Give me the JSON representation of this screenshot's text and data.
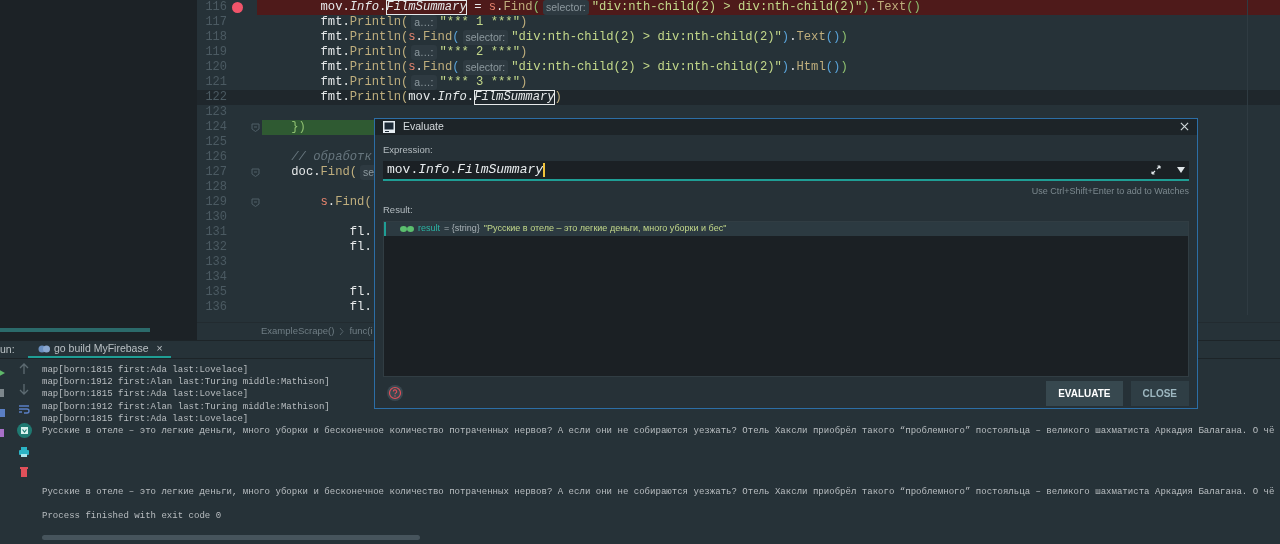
{
  "editor": {
    "lines": [
      {
        "number": "116",
        "breakpoint": true,
        "current": false,
        "highlighted": false,
        "foldable": false,
        "tokens": [
          {
            "text": "        mov.",
            "kind": "plain"
          },
          {
            "text": "Info",
            "kind": "field"
          },
          {
            "text": ".",
            "kind": "plain"
          },
          {
            "text": "FilmSummary",
            "kind": "boxed"
          },
          {
            "text": " = ",
            "kind": "plain"
          },
          {
            "text": "s",
            "kind": "receiver"
          },
          {
            "text": ".",
            "kind": "plain"
          },
          {
            "text": "Find",
            "kind": "method"
          },
          {
            "text": "(",
            "kind": "paren-green"
          },
          {
            "text": "selector:",
            "kind": "hint"
          },
          {
            "text": "\"div:nth-child(2) > div:nth-child(2)\"",
            "kind": "string"
          },
          {
            "text": ")",
            "kind": "paren-green"
          },
          {
            "text": ".",
            "kind": "plain"
          },
          {
            "text": "Text",
            "kind": "method"
          },
          {
            "text": "()",
            "kind": "paren-green"
          }
        ]
      },
      {
        "number": "117",
        "breakpoint": false,
        "current": false,
        "highlighted": false,
        "foldable": false,
        "tokens": [
          {
            "text": "        fmt.",
            "kind": "plain"
          },
          {
            "text": "Println(",
            "kind": "method"
          },
          {
            "text": "a…:",
            "kind": "hint"
          },
          {
            "text": "\"*** 1 ***\"",
            "kind": "string"
          },
          {
            "text": ")",
            "kind": "method"
          }
        ]
      },
      {
        "number": "118",
        "breakpoint": false,
        "current": false,
        "highlighted": false,
        "foldable": false,
        "tokens": [
          {
            "text": "        fmt.",
            "kind": "plain"
          },
          {
            "text": "Println(",
            "kind": "method"
          },
          {
            "text": "s",
            "kind": "receiver"
          },
          {
            "text": ".",
            "kind": "plain"
          },
          {
            "text": "Find",
            "kind": "method"
          },
          {
            "text": "(",
            "kind": "paren-blue"
          },
          {
            "text": "selector:",
            "kind": "hint"
          },
          {
            "text": "\"div:nth-child(2) > div:nth-child(2)\"",
            "kind": "string"
          },
          {
            "text": ")",
            "kind": "paren-blue"
          },
          {
            "text": ".",
            "kind": "plain"
          },
          {
            "text": "Text",
            "kind": "method"
          },
          {
            "text": "()",
            "kind": "paren-blue"
          },
          {
            "text": ")",
            "kind": "paren-green"
          }
        ]
      },
      {
        "number": "119",
        "breakpoint": false,
        "current": false,
        "highlighted": false,
        "foldable": false,
        "tokens": [
          {
            "text": "        fmt.",
            "kind": "plain"
          },
          {
            "text": "Println(",
            "kind": "method"
          },
          {
            "text": "a…:",
            "kind": "hint"
          },
          {
            "text": "\"*** 2 ***\"",
            "kind": "string"
          },
          {
            "text": ")",
            "kind": "method"
          }
        ]
      },
      {
        "number": "120",
        "breakpoint": false,
        "current": false,
        "highlighted": false,
        "foldable": false,
        "tokens": [
          {
            "text": "        fmt.",
            "kind": "plain"
          },
          {
            "text": "Println(",
            "kind": "method"
          },
          {
            "text": "s",
            "kind": "receiver"
          },
          {
            "text": ".",
            "kind": "plain"
          },
          {
            "text": "Find",
            "kind": "method"
          },
          {
            "text": "(",
            "kind": "paren-blue"
          },
          {
            "text": "selector:",
            "kind": "hint"
          },
          {
            "text": "\"div:nth-child(2) > div:nth-child(2)\"",
            "kind": "string"
          },
          {
            "text": ")",
            "kind": "paren-blue"
          },
          {
            "text": ".",
            "kind": "plain"
          },
          {
            "text": "Html",
            "kind": "method"
          },
          {
            "text": "()",
            "kind": "paren-blue"
          },
          {
            "text": ")",
            "kind": "paren-green"
          }
        ]
      },
      {
        "number": "121",
        "breakpoint": false,
        "current": false,
        "highlighted": false,
        "foldable": false,
        "tokens": [
          {
            "text": "        fmt.",
            "kind": "plain"
          },
          {
            "text": "Println(",
            "kind": "method"
          },
          {
            "text": "a…:",
            "kind": "hint"
          },
          {
            "text": "\"*** 3 ***\"",
            "kind": "string"
          },
          {
            "text": ")",
            "kind": "method"
          }
        ]
      },
      {
        "number": "122",
        "breakpoint": false,
        "current": true,
        "highlighted": false,
        "foldable": false,
        "tokens": [
          {
            "text": "        fmt.",
            "kind": "plain"
          },
          {
            "text": "Println(",
            "kind": "method"
          },
          {
            "text": "mov.",
            "kind": "plain"
          },
          {
            "text": "Info",
            "kind": "field"
          },
          {
            "text": ".",
            "kind": "plain"
          },
          {
            "text": "FilmSummary",
            "kind": "boxed"
          },
          {
            "text": ")",
            "kind": "method"
          }
        ]
      },
      {
        "number": "123",
        "breakpoint": false,
        "current": false,
        "highlighted": false,
        "foldable": false
      },
      {
        "number": "124",
        "breakpoint": false,
        "current": false,
        "highlighted": true,
        "foldable": true,
        "tokens": [
          {
            "text": "    })",
            "kind": "paren-green"
          }
        ]
      },
      {
        "number": "125",
        "breakpoint": false,
        "current": false,
        "highlighted": false,
        "foldable": false
      },
      {
        "number": "126",
        "breakpoint": false,
        "current": false,
        "highlighted": false,
        "foldable": false,
        "tokens": [
          {
            "text": "    // обработк",
            "kind": "comment"
          }
        ]
      },
      {
        "number": "127",
        "breakpoint": false,
        "current": false,
        "highlighted": false,
        "foldable": true,
        "tokens": [
          {
            "text": "    doc.",
            "kind": "plain"
          },
          {
            "text": "Find(",
            "kind": "method"
          },
          {
            "text": "se",
            "kind": "hint"
          }
        ]
      },
      {
        "number": "128",
        "breakpoint": false,
        "current": false,
        "highlighted": false,
        "foldable": false
      },
      {
        "number": "129",
        "breakpoint": false,
        "current": false,
        "highlighted": false,
        "foldable": true,
        "tokens": [
          {
            "text": "        s",
            "kind": "receiver"
          },
          {
            "text": ".",
            "kind": "plain"
          },
          {
            "text": "Find(",
            "kind": "method"
          }
        ]
      },
      {
        "number": "130",
        "breakpoint": false,
        "current": false,
        "highlighted": false,
        "foldable": false
      },
      {
        "number": "131",
        "breakpoint": false,
        "current": false,
        "highlighted": false,
        "foldable": false,
        "tokens": [
          {
            "text": "            fl.",
            "kind": "plain"
          }
        ]
      },
      {
        "number": "132",
        "breakpoint": false,
        "current": false,
        "highlighted": false,
        "foldable": false,
        "tokens": [
          {
            "text": "            fl.",
            "kind": "plain"
          }
        ]
      },
      {
        "number": "133",
        "breakpoint": false,
        "current": false,
        "highlighted": false,
        "foldable": false
      },
      {
        "number": "134",
        "breakpoint": false,
        "current": false,
        "highlighted": false,
        "foldable": false
      },
      {
        "number": "135",
        "breakpoint": false,
        "current": false,
        "highlighted": false,
        "foldable": false,
        "tokens": [
          {
            "text": "            fl.",
            "kind": "plain"
          }
        ]
      },
      {
        "number": "136",
        "breakpoint": false,
        "current": false,
        "highlighted": false,
        "foldable": false,
        "tokens": [
          {
            "text": "            fl.",
            "kind": "plain"
          }
        ]
      }
    ],
    "breadcrumbs": [
      "ExampleScrape()",
      "func(i"
    ]
  },
  "run_panel": {
    "label": "un:",
    "tab": {
      "title": "go build MyFirebase",
      "close": "×",
      "selected": true
    },
    "console": [
      {
        "kind": "text",
        "text": "map[born:1815 first:Ada last:Lovelace]"
      },
      {
        "kind": "text",
        "text": "map[born:1912 first:Alan last:Turing middle:Mathison]"
      },
      {
        "kind": "text",
        "text": "map[born:1815 first:Ada last:Lovelace]"
      },
      {
        "kind": "text",
        "text": "map[born:1912 first:Alan last:Turing middle:Mathison]"
      },
      {
        "kind": "text",
        "text": "map[born:1815 first:Ada last:Lovelace]"
      },
      {
        "kind": "text",
        "text": "Русские в отеле – это легкие деньги, много уборки и бесконечное количество потраченных нервов? А если они не собираются уезжать? Отель Хаксли приобрёл такого “проблемного” постояльца – великого шахматиста Аркадия Балагана. О чё"
      },
      {
        "kind": "blank"
      },
      {
        "kind": "blank"
      },
      {
        "kind": "blank"
      },
      {
        "kind": "blank"
      },
      {
        "kind": "text",
        "text": "Русские в отеле – это легкие деньги, много уборки и бесконечное количество потраченных нервов? А если они не собираются уезжать? Отель Хаксли приобрёл такого “проблемного” постояльца – великого шахматиста Аркадия Балагана. О чё"
      },
      {
        "kind": "blank"
      },
      {
        "kind": "text",
        "text": "Process finished with exit code 0"
      }
    ]
  },
  "dialog": {
    "title": "Evaluate",
    "expression_label": "Expression:",
    "expression": "mov.*Info*.*FilmSummary*",
    "hint": "Use Ctrl+Shift+Enter to add to Watches",
    "result_label": "Result:",
    "result": {
      "name": "result",
      "type": "= {string}",
      "value": "\"Русские в отеле – это легкие деньги, много уборки и бес\"",
      "selected": true
    },
    "buttons": [
      {
        "label": "EVALUATE",
        "default": true
      },
      {
        "label": "CLOSE",
        "default": false
      }
    ]
  }
}
